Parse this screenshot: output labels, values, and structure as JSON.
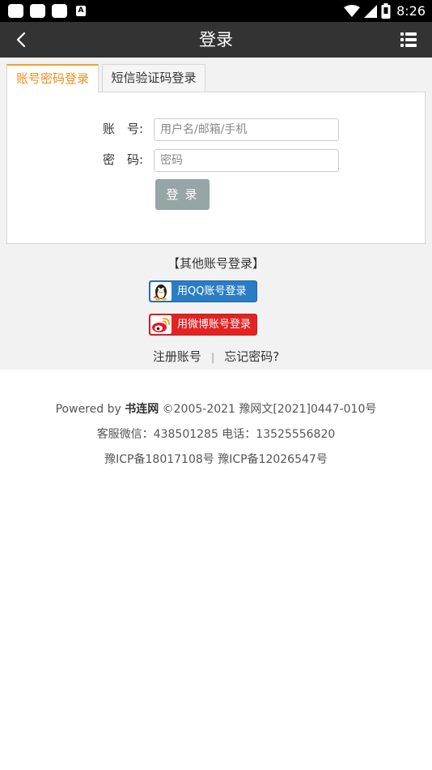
{
  "status_bar": {
    "time": "8:26",
    "a_badge": "A",
    "icons": [
      "app-square-icon",
      "app-square-icon",
      "app-square-icon",
      "a-notification-icon",
      "wifi-icon",
      "cellular-signal-icon",
      "battery-icon"
    ]
  },
  "nav": {
    "title": "登录",
    "back_icon": "chevron-left-icon",
    "menu_icon": "list-menu-icon"
  },
  "tabs": [
    {
      "label": "账号密码登录",
      "active": true
    },
    {
      "label": "短信验证码登录",
      "active": false
    }
  ],
  "form": {
    "account_label": "账　号:",
    "account_placeholder": "用户名/邮箱/手机",
    "password_label": "密　码:",
    "password_placeholder": "密码",
    "submit_label": "登录"
  },
  "other_login": {
    "title": "【其他账号登录】",
    "qq_label": "用QQ账号登录",
    "weibo_label": "用微博账号登录"
  },
  "links": {
    "register": "注册账号",
    "separator": "|",
    "forgot": "忘记密码?"
  },
  "footer": {
    "powered_prefix": "Powered by ",
    "brand": "书连网",
    "powered_suffix": " ©2005-2021 豫网文[2021]0447-010号",
    "contact": "客服微信：438501285 电话：13525556820",
    "icp": "豫ICP备18017108号 豫ICP备12026547号"
  },
  "colors": {
    "nav_bg": "#333333",
    "tab_active_text": "#f08c1a",
    "login_button": "#96a5a5",
    "qq_blue": "#2a7dc4",
    "weibo_red": "#e32323"
  }
}
